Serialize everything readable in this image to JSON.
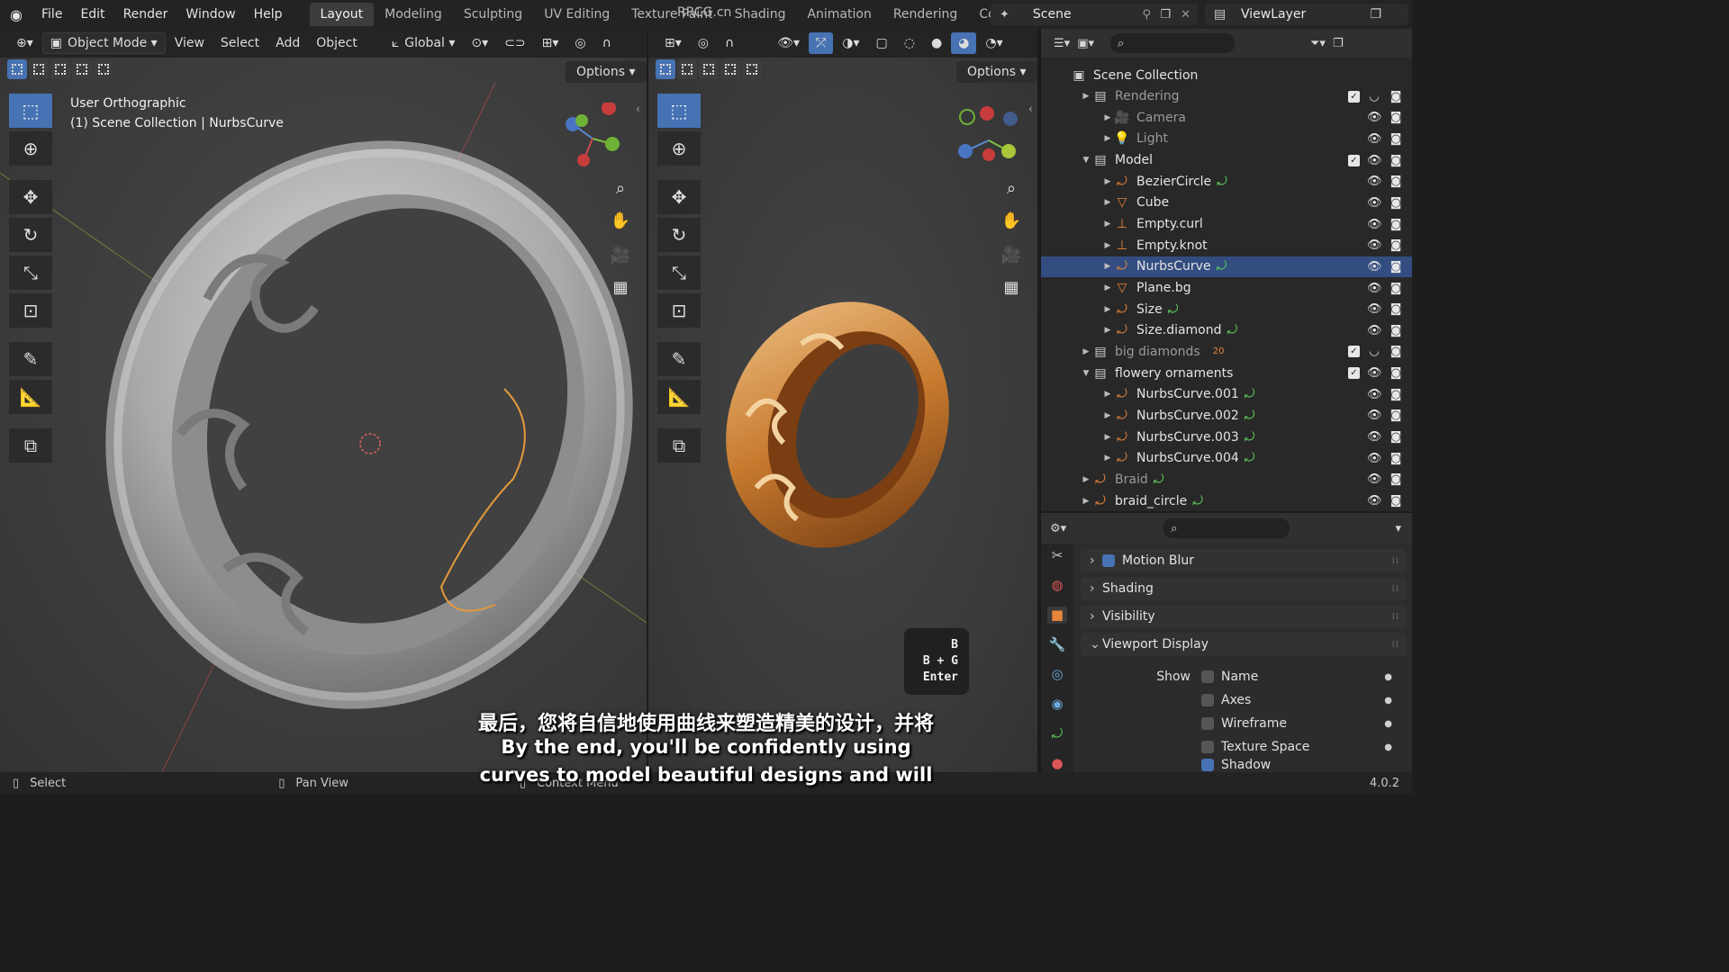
{
  "app": {
    "menus": [
      "File",
      "Edit",
      "Render",
      "Window",
      "Help"
    ],
    "workspaces": [
      "Layout",
      "Modeling",
      "Sculpting",
      "UV Editing",
      "Texture Paint",
      "Shading",
      "Animation",
      "Rendering",
      "Compositing"
    ],
    "active_workspace": "Layout",
    "scene": "Scene",
    "view_layer": "ViewLayer",
    "watermark": "RRCG.cn",
    "version": "4.0.2",
    "accent_color": "#4772b3"
  },
  "viewport_left": {
    "mode": "Object Mode",
    "menus": [
      "View",
      "Select",
      "Add",
      "Object"
    ],
    "orientation": "Global",
    "options_label": "Options",
    "info_line1": "User Orthographic",
    "info_line2": "(1) Scene Collection | NurbsCurve"
  },
  "viewport_right": {
    "options_label": "Options",
    "key_hint": [
      "B",
      "B + G",
      "Enter"
    ]
  },
  "outliner": {
    "rows": [
      {
        "label": "Scene Collection",
        "type": "scene-collection",
        "indent": 0
      },
      {
        "label": "Rendering",
        "type": "collection",
        "indent": 1,
        "dim": true
      },
      {
        "label": "Camera",
        "type": "camera",
        "indent": 2,
        "dim": true
      },
      {
        "label": "Light",
        "type": "light",
        "indent": 2,
        "dim": true
      },
      {
        "label": "Model",
        "type": "collection",
        "indent": 1
      },
      {
        "label": "BezierCircle",
        "type": "curve",
        "indent": 2
      },
      {
        "label": "Cube",
        "type": "mesh",
        "indent": 2
      },
      {
        "label": "Empty.curl",
        "type": "empty",
        "indent": 2
      },
      {
        "label": "Empty.knot",
        "type": "empty",
        "indent": 2
      },
      {
        "label": "NurbsCurve",
        "type": "curve",
        "indent": 2,
        "selected": true
      },
      {
        "label": "Plane.bg",
        "type": "mesh",
        "indent": 2
      },
      {
        "label": "Size",
        "type": "curve",
        "indent": 2
      },
      {
        "label": "Size.diamond",
        "type": "curve",
        "indent": 2
      },
      {
        "label": "big diamonds",
        "type": "collection",
        "indent": 1,
        "dim": true,
        "badge": "20"
      },
      {
        "label": "flowery ornaments",
        "type": "collection",
        "indent": 1
      },
      {
        "label": "NurbsCurve.001",
        "type": "curve",
        "indent": 2
      },
      {
        "label": "NurbsCurve.002",
        "type": "curve",
        "indent": 2
      },
      {
        "label": "NurbsCurve.003",
        "type": "curve",
        "indent": 2
      },
      {
        "label": "NurbsCurve.004",
        "type": "curve",
        "indent": 2
      },
      {
        "label": "Braid",
        "type": "curve",
        "indent": 1,
        "dim": true
      },
      {
        "label": "braid_circle",
        "type": "curve",
        "indent": 1
      }
    ]
  },
  "properties": {
    "panels": [
      "Motion Blur",
      "Shading",
      "Visibility",
      "Viewport Display"
    ],
    "show_label": "Show",
    "show_options": [
      "Name",
      "Axes",
      "Wireframe",
      "Texture Space",
      "Shadow"
    ]
  },
  "statusbar": {
    "left": "Select",
    "middle": "Pan View",
    "right": "Context Menu"
  },
  "subtitles": {
    "chinese": "最后，您将自信地使用曲线来塑造精美的设计，并将",
    "english_line1": "By the end, you'll be confidently using",
    "english_line2": "curves to model beautiful designs and will"
  }
}
